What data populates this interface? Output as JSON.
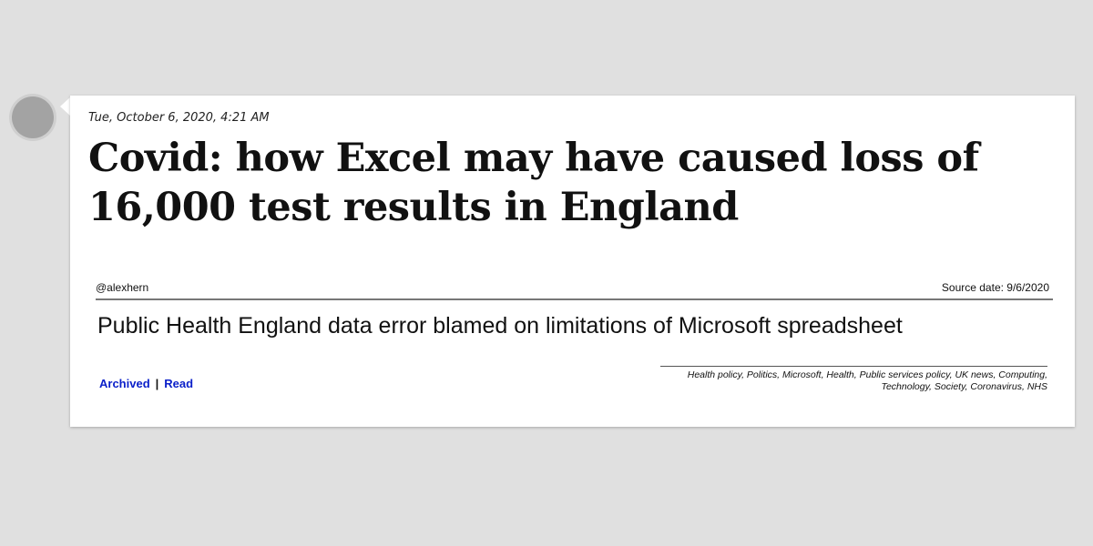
{
  "post": {
    "timestamp": "Tue, October 6, 2020, 4:21 AM",
    "headline": "Covid: how Excel may have caused loss of 16,000 test results in England",
    "author": "@alexhern",
    "source_date": "Source date: 9/6/2020",
    "subtitle": "Public Health England data error blamed on limitations of Microsoft spreadsheet",
    "links": {
      "archived": "Archived",
      "separator": "|",
      "read": "Read"
    },
    "tags": "Health policy, Politics, Microsoft, Health, Public services policy, UK news, Computing, Technology, Society, Coronavirus, NHS"
  },
  "colors": {
    "background": "#e0e0e0",
    "card": "#ffffff",
    "link": "#0a1fc9",
    "avatar": "#a3a3a3"
  }
}
